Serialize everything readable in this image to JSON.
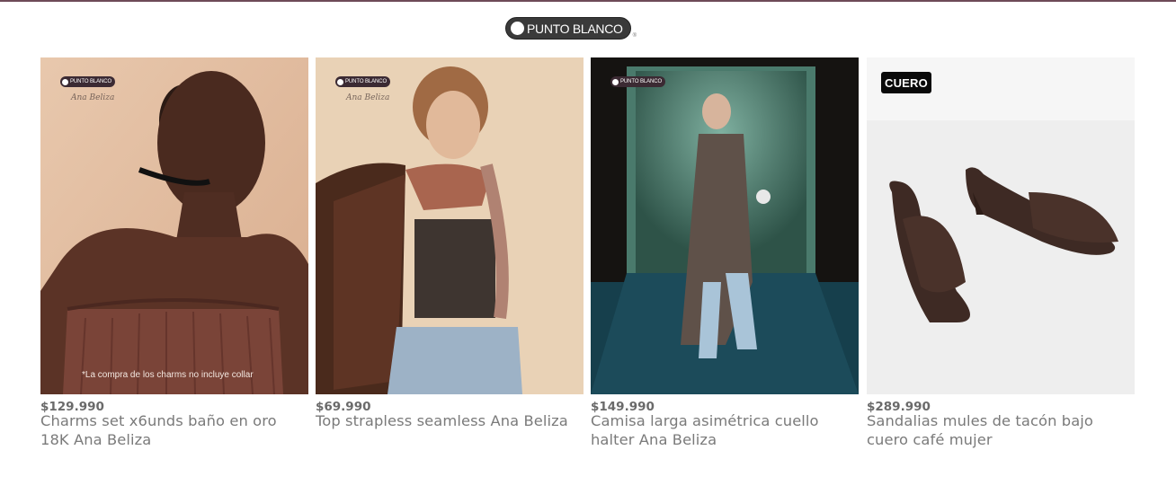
{
  "brand": {
    "logo_text": "PUNTO BLANCO",
    "reg_mark": "®"
  },
  "colors": {
    "accent_rule": "#6e4a58",
    "price": "#6a6a6a",
    "title": "#7a7a7a"
  },
  "products": [
    {
      "title": "Charms set x6unds baño en oro 18K Ana Beliza",
      "price": "$129.990",
      "logo_text": "PUNTO BLANCO",
      "signature": "Ana Beliza",
      "note": "*La compra de los charms no incluye collar"
    },
    {
      "title": "Top strapless seamless Ana Beliza",
      "price": "$69.990",
      "logo_text": "PUNTO BLANCO",
      "signature": "Ana Beliza"
    },
    {
      "title": "Camisa larga asimétrica cuello halter Ana Beliza",
      "price": "$149.990",
      "logo_text": "PUNTO BLANCO"
    },
    {
      "title": "Sandalias mules de tacón bajo cuero café mujer",
      "price": "$289.990",
      "badge": "CUERO"
    }
  ]
}
